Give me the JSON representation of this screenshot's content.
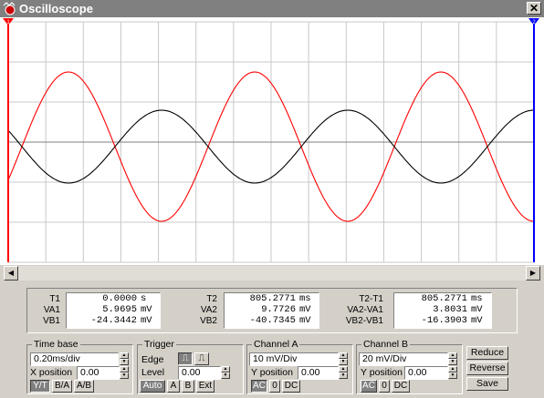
{
  "window": {
    "title": "Oscilloscope",
    "icon": "oscilloscope-app-icon",
    "close_icon": "close-icon"
  },
  "cursors": {
    "t1_marker": "1",
    "t2_marker": "2"
  },
  "readout": {
    "col1": [
      {
        "label": "T1",
        "value": "0.0000",
        "unit": "s"
      },
      {
        "label": "VA1",
        "value": "5.9695",
        "unit": "mV"
      },
      {
        "label": "VB1",
        "value": "-24.3442",
        "unit": "mV"
      }
    ],
    "col2": [
      {
        "label": "T2",
        "value": "805.2771",
        "unit": "ms"
      },
      {
        "label": "VA2",
        "value": "9.7726",
        "unit": "mV"
      },
      {
        "label": "VB2",
        "value": "-40.7345",
        "unit": "mV"
      }
    ],
    "col3": [
      {
        "label": "T2-T1",
        "value": "805.2771",
        "unit": "ms"
      },
      {
        "label": "VA2-VA1",
        "value": "3.8031",
        "unit": "mV"
      },
      {
        "label": "VB2-VB1",
        "value": "-16.3903",
        "unit": "mV"
      }
    ]
  },
  "timebase": {
    "title": "Time base",
    "scale": "0.20ms/div",
    "xpos_label": "X position",
    "xpos_value": "0.00",
    "buttons": [
      "Y/T",
      "B/A",
      "A/B"
    ]
  },
  "trigger": {
    "title": "Trigger",
    "edge_label": "Edge",
    "level_label": "Level",
    "level_value": "0.00",
    "buttons": [
      "Auto",
      "A",
      "B",
      "Ext"
    ]
  },
  "channel_a": {
    "title": "Channel A",
    "scale": "10 mV/Div",
    "ypos_label": "Y position",
    "ypos_value": "0.00",
    "buttons": [
      "AC",
      "0",
      "DC"
    ]
  },
  "channel_b": {
    "title": "Channel B",
    "scale": "20 mV/Div",
    "ypos_label": "Y position",
    "ypos_value": "0.00",
    "buttons": [
      "AC",
      "0",
      "DC"
    ]
  },
  "actions": {
    "reduce": "Reduce",
    "reverse": "Reverse",
    "save": "Save"
  },
  "colors": {
    "channel_a_trace": "#000000",
    "channel_b_trace": "#ff0000",
    "cursor_t1": "#ff0000",
    "cursor_t2": "#0000ff",
    "grid": "#c0c0c0"
  }
}
